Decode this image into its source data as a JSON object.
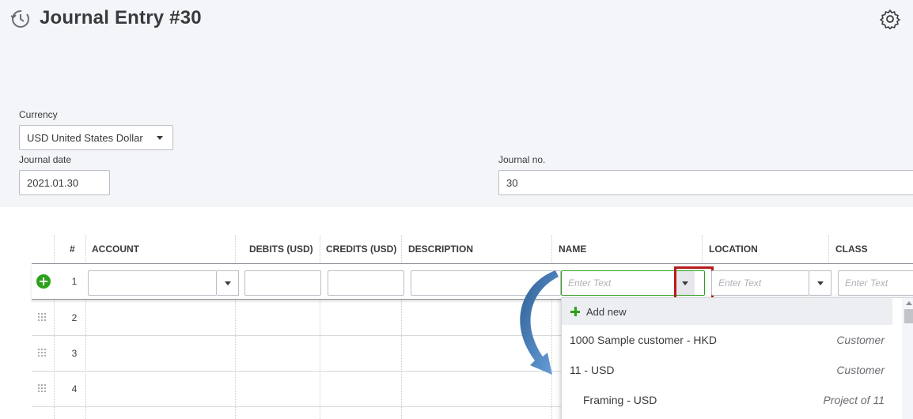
{
  "header": {
    "title": "Journal Entry #30",
    "history_icon": "history-clock-icon",
    "settings_icon": "gear-icon"
  },
  "form": {
    "currency_label": "Currency",
    "currency_value": "USD United States Dollar",
    "journal_date_label": "Journal date",
    "journal_date_value": "2021.01.30",
    "journal_no_label": "Journal no.",
    "journal_no_value": "30"
  },
  "table": {
    "columns": [
      "#",
      "ACCOUNT",
      "DEBITS (USD)",
      "CREDITS (USD)",
      "DESCRIPTION",
      "NAME",
      "LOCATION",
      "CLASS"
    ],
    "rows": [
      "1",
      "2",
      "3",
      "4"
    ],
    "placeholder": "Enter Text"
  },
  "dropdown": {
    "add_new": "Add new",
    "items": [
      {
        "name": "1000 Sample customer - HKD",
        "type": "Customer"
      },
      {
        "name": "11 - USD",
        "type": "Customer"
      },
      {
        "name": "Framing - USD",
        "type": "Project of 11"
      }
    ]
  },
  "colors": {
    "accent_green": "#2ca01c",
    "highlight_red": "#b71c1c",
    "arrow_blue": "#4a86c5",
    "panel_bg": "#f4f5f8"
  }
}
